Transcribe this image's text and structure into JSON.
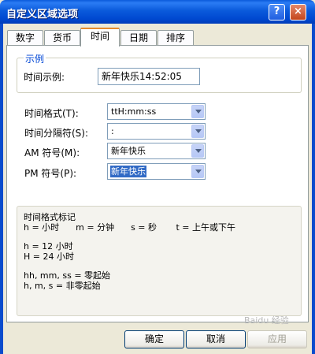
{
  "window": {
    "title": "自定义区域选项"
  },
  "titlebar": {
    "help_label": "?",
    "close_label": "×"
  },
  "tabs": [
    {
      "label": "数字"
    },
    {
      "label": "货币"
    },
    {
      "label": "时间"
    },
    {
      "label": "日期"
    },
    {
      "label": "排序"
    }
  ],
  "active_tab": "时间",
  "example": {
    "group_label": "示例",
    "sample_label": "时间示例:",
    "sample_value": "新年快乐14:52:05"
  },
  "fields": [
    {
      "label": "时间格式(T):",
      "value": "ttH:mm:ss"
    },
    {
      "label": "时间分隔符(S):",
      "value": ":"
    },
    {
      "label": "AM 符号(M):",
      "value": "新年快乐"
    },
    {
      "label": "PM 符号(P):",
      "value": "新年快乐"
    }
  ],
  "notation": {
    "title": "时间格式标记",
    "line1": "h = 小时      m = 分钟      s = 秒       t = 上午或下午",
    "line2": "h = 12 小时",
    "line3": "H = 24 小时",
    "line4": "hh, mm, ss = 零起始",
    "line5": "h, m, s = 非零起始"
  },
  "buttons": {
    "ok": "确定",
    "cancel": "取消",
    "apply": "应用"
  },
  "watermark": "Baidu 经验",
  "colors": {
    "title_bar": "#0a5adb",
    "group_title": "#0046d5",
    "active_tab_accent": "#e68b2c",
    "selection": "#316ac5"
  }
}
